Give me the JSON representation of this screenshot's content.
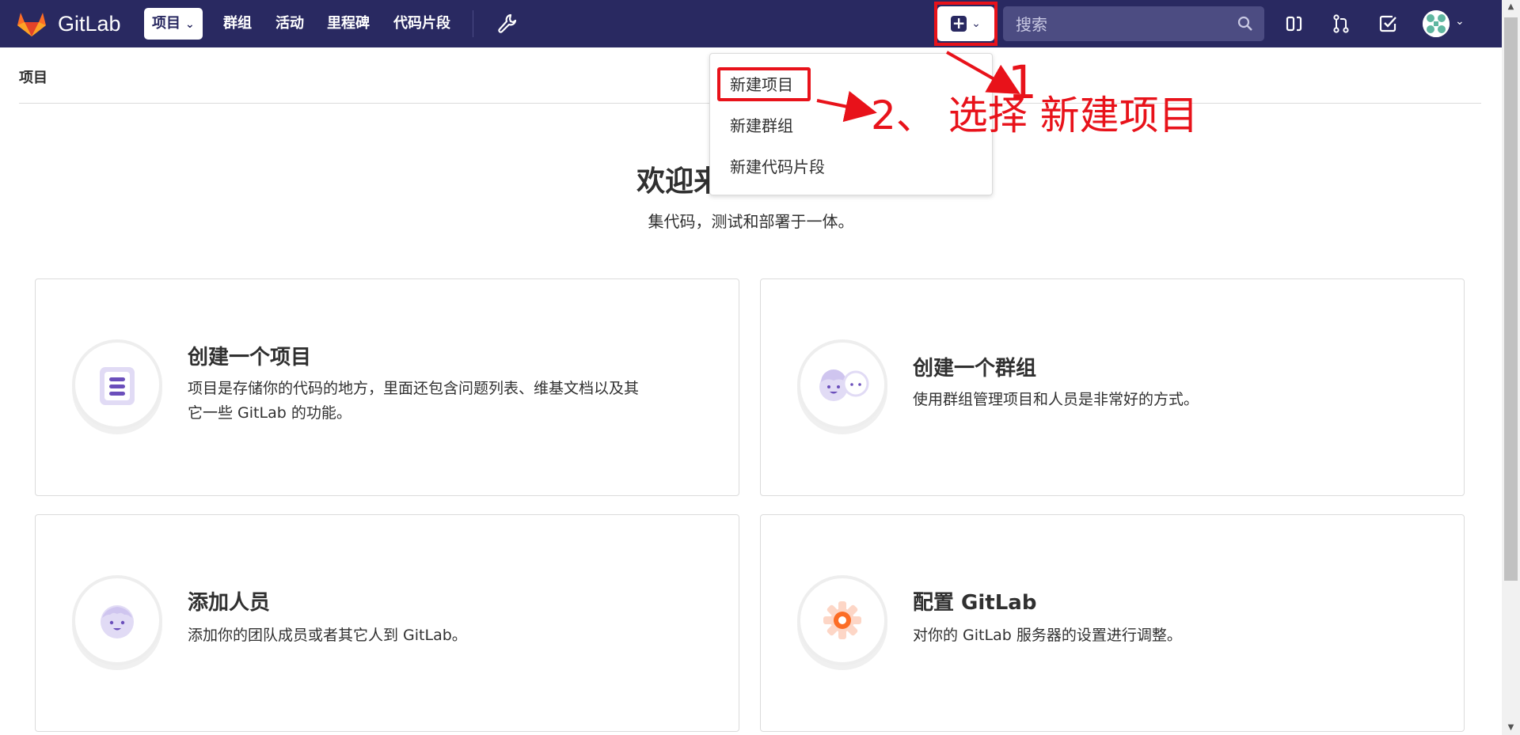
{
  "navbar": {
    "brand": "GitLab",
    "items": [
      {
        "label": "项目"
      },
      {
        "label": "群组"
      },
      {
        "label": "活动"
      },
      {
        "label": "里程碑"
      },
      {
        "label": "代码片段"
      }
    ],
    "search_placeholder": "搜索",
    "accent_color": "#292961"
  },
  "dropdown": {
    "items": [
      "新建项目",
      "新建群组",
      "新建代码片段"
    ]
  },
  "breadcrumb": "项目",
  "welcome": {
    "title": "欢迎来到 GitLab",
    "subtitle": "集代码，测试和部署于一体。"
  },
  "annotations": {
    "step1": "1",
    "step2": "2、 选择 新建项目",
    "color": "#e8121a"
  },
  "cards": [
    {
      "title": "创建一个项目",
      "desc_line1": "项目是存储你的代码的地方，里面还包含问题列表、维基文档以及其",
      "desc_line2": "它一些 GitLab 的功能。",
      "icon": "project-icon"
    },
    {
      "title": "创建一个群组",
      "desc_line1": "使用群组管理项目和人员是非常好的方式。",
      "icon": "group-icon"
    },
    {
      "title": "添加人员",
      "desc_line1": "添加你的团队成员或者其它人到 GitLab。",
      "icon": "person-icon"
    },
    {
      "title": "配置 GitLab",
      "desc_line1": "对你的 GitLab 服务器的设置进行调整。",
      "icon": "settings-gear-icon"
    }
  ]
}
